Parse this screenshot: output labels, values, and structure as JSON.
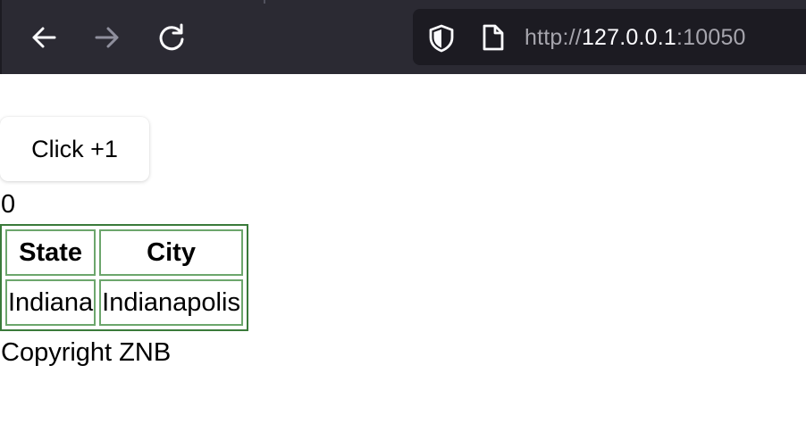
{
  "browser": {
    "back_icon": "arrow-left-icon",
    "forward_icon": "arrow-right-icon",
    "reload_icon": "reload-icon",
    "security_icon": "shield-icon",
    "page_icon": "page-icon",
    "url_scheme": "http://",
    "url_host": "127.0.0.1",
    "url_port": ":10050"
  },
  "page": {
    "button_label": "Click +1",
    "counter_value": "0",
    "table": {
      "headers": [
        "State",
        "City"
      ],
      "rows": [
        [
          "Indiana",
          "Indianapolis"
        ]
      ]
    },
    "footer": "Copyright ZNB"
  },
  "colors": {
    "toolbar_bg": "#2b2a33",
    "urlbar_bg": "#1c1b22",
    "table_border": "#3a7a3a",
    "cell_border": "#6ca66c"
  }
}
